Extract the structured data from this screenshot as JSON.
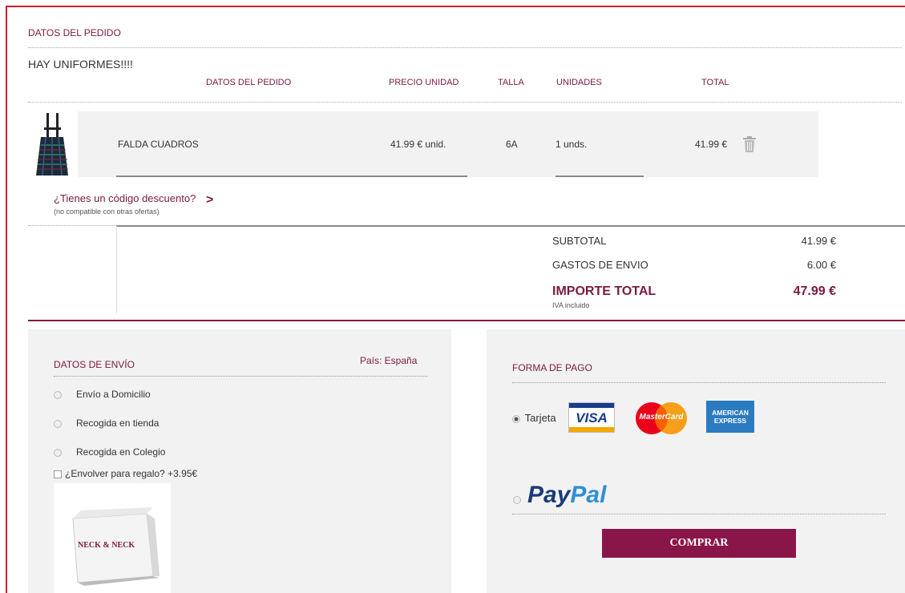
{
  "order": {
    "section_title": "DATOS DEL PEDIDO",
    "heading": "HAY UNIFORMES!!!!",
    "columns": {
      "product": "DATOS DEL PEDIDO",
      "unit_price": "PRECIO UNIDAD",
      "size": "TALLA",
      "units": "UNIDADES",
      "total": "TOTAL"
    },
    "items": [
      {
        "name": "FALDA CUADROS",
        "unit_price": "41.99 € unid.",
        "size": "6A",
        "units": "1 unds.",
        "total": "41.99 €",
        "thumb_icon": "skirt-thumbnail",
        "delete_icon": "trash-icon"
      }
    ],
    "discount": {
      "link": "¿Tienes un código descuento?",
      "arrow": ">",
      "note": "(no compatible con otras ofertas)"
    },
    "totals": {
      "subtotal_label": "SUBTOTAL",
      "subtotal_value": "41.99 €",
      "shipping_label": "GASTOS DE ENVIO",
      "shipping_value": "6.00 €",
      "total_label": "IMPORTE TOTAL",
      "total_value": "47.99 €",
      "vat_note": "IVA incluido"
    }
  },
  "shipping": {
    "title": "DATOS DE ENVÍO",
    "country": "País: España",
    "options": [
      {
        "label": "Envío a Domicilio",
        "selected": false
      },
      {
        "label": "Recogida en tienda",
        "selected": false
      },
      {
        "label": "Recogida en Colegio",
        "selected": false
      }
    ],
    "gift": {
      "label": "¿Envolver para regalo? +3.95€",
      "checked": false,
      "box_text": "NECK & NECK"
    }
  },
  "payment": {
    "title": "FORMA DE PAGO",
    "card_label": "Tarjeta",
    "card_selected": true,
    "card_logos": {
      "visa": "VISA",
      "mastercard": "MasterCard",
      "amex_line1": "AMERICAN",
      "amex_line2": "EXPRESS"
    },
    "paypal_label_1": "Pay",
    "paypal_label_2": "Pal",
    "paypal_selected": false,
    "buy_button": "COMPRAR"
  },
  "colors": {
    "accent": "#7a1a40",
    "button": "#8a1549",
    "frame": "#d42027",
    "panel_bg": "#f2f2f2"
  }
}
